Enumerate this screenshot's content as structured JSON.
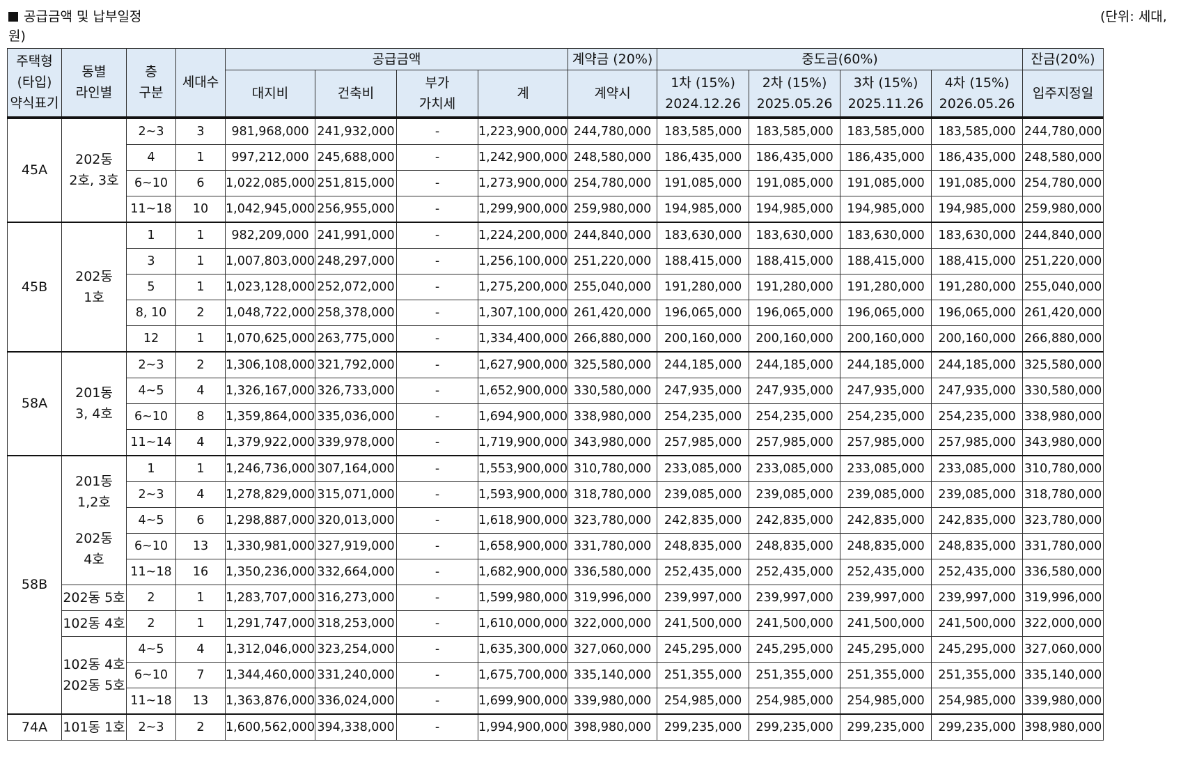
{
  "page": {
    "title": "공급금액 및 납부일정",
    "unit_line1": "(단위: 세대,",
    "unit_line2": "원)"
  },
  "header": {
    "type": [
      "주택형",
      "(타입)",
      "약식표기"
    ],
    "dong": [
      "동별",
      "라인별"
    ],
    "floor": [
      "층",
      "구분"
    ],
    "units": "세대수",
    "supply_group": "공급금액",
    "land": "대지비",
    "building": "건축비",
    "vat": [
      "부가",
      "가치세"
    ],
    "total": "계",
    "contract_group": "계약금 (20%)",
    "contract_sub": "계약시",
    "middle_group": "중도금(60%)",
    "m1": "1차 (15%)",
    "m1_date": "2024.12.26",
    "m2": "2차 (15%)",
    "m2_date": "2025.05.26",
    "m3": "3차 (15%)",
    "m3_date": "2025.11.26",
    "m4": "4차 (15%)",
    "m4_date": "2026.05.26",
    "balance_group": "잔금(20%)",
    "balance_sub": "입주지정일"
  },
  "groups": [
    {
      "type": "45A",
      "lines": [
        [
          "202동",
          "2호, 3호"
        ]
      ]
    },
    {
      "type": "45B",
      "lines": [
        [
          "202동",
          "1호"
        ]
      ]
    },
    {
      "type": "58A",
      "lines": [
        [
          "201동",
          "3, 4호"
        ]
      ]
    },
    {
      "type": "58B",
      "lines": [
        [
          "201동",
          "1,2호",
          "",
          "202동",
          "4호"
        ],
        [
          "202동 5호"
        ],
        [
          "102동 4호"
        ],
        [
          "102동 4호",
          "202동 5호"
        ]
      ]
    },
    {
      "type": "74A",
      "lines": [
        [
          "101동 1호"
        ]
      ]
    }
  ],
  "rows": [
    {
      "floor": "2~3",
      "units": "3",
      "land": "981,968,000",
      "building": "241,932,000",
      "vat": "-",
      "total": "1,223,900,000",
      "contract": "244,780,000",
      "m1": "183,585,000",
      "m2": "183,585,000",
      "m3": "183,585,000",
      "m4": "183,585,000",
      "balance": "244,780,000"
    },
    {
      "floor": "4",
      "units": "1",
      "land": "997,212,000",
      "building": "245,688,000",
      "vat": "-",
      "total": "1,242,900,000",
      "contract": "248,580,000",
      "m1": "186,435,000",
      "m2": "186,435,000",
      "m3": "186,435,000",
      "m4": "186,435,000",
      "balance": "248,580,000"
    },
    {
      "floor": "6~10",
      "units": "6",
      "land": "1,022,085,000",
      "building": "251,815,000",
      "vat": "-",
      "total": "1,273,900,000",
      "contract": "254,780,000",
      "m1": "191,085,000",
      "m2": "191,085,000",
      "m3": "191,085,000",
      "m4": "191,085,000",
      "balance": "254,780,000"
    },
    {
      "floor": "11~18",
      "units": "10",
      "land": "1,042,945,000",
      "building": "256,955,000",
      "vat": "-",
      "total": "1,299,900,000",
      "contract": "259,980,000",
      "m1": "194,985,000",
      "m2": "194,985,000",
      "m3": "194,985,000",
      "m4": "194,985,000",
      "balance": "259,980,000"
    },
    {
      "floor": "1",
      "units": "1",
      "land": "982,209,000",
      "building": "241,991,000",
      "vat": "-",
      "total": "1,224,200,000",
      "contract": "244,840,000",
      "m1": "183,630,000",
      "m2": "183,630,000",
      "m3": "183,630,000",
      "m4": "183,630,000",
      "balance": "244,840,000"
    },
    {
      "floor": "3",
      "units": "1",
      "land": "1,007,803,000",
      "building": "248,297,000",
      "vat": "-",
      "total": "1,256,100,000",
      "contract": "251,220,000",
      "m1": "188,415,000",
      "m2": "188,415,000",
      "m3": "188,415,000",
      "m4": "188,415,000",
      "balance": "251,220,000"
    },
    {
      "floor": "5",
      "units": "1",
      "land": "1,023,128,000",
      "building": "252,072,000",
      "vat": "-",
      "total": "1,275,200,000",
      "contract": "255,040,000",
      "m1": "191,280,000",
      "m2": "191,280,000",
      "m3": "191,280,000",
      "m4": "191,280,000",
      "balance": "255,040,000"
    },
    {
      "floor": "8, 10",
      "units": "2",
      "land": "1,048,722,000",
      "building": "258,378,000",
      "vat": "-",
      "total": "1,307,100,000",
      "contract": "261,420,000",
      "m1": "196,065,000",
      "m2": "196,065,000",
      "m3": "196,065,000",
      "m4": "196,065,000",
      "balance": "261,420,000"
    },
    {
      "floor": "12",
      "units": "1",
      "land": "1,070,625,000",
      "building": "263,775,000",
      "vat": "-",
      "total": "1,334,400,000",
      "contract": "266,880,000",
      "m1": "200,160,000",
      "m2": "200,160,000",
      "m3": "200,160,000",
      "m4": "200,160,000",
      "balance": "266,880,000"
    },
    {
      "floor": "2~3",
      "units": "2",
      "land": "1,306,108,000",
      "building": "321,792,000",
      "vat": "-",
      "total": "1,627,900,000",
      "contract": "325,580,000",
      "m1": "244,185,000",
      "m2": "244,185,000",
      "m3": "244,185,000",
      "m4": "244,185,000",
      "balance": "325,580,000"
    },
    {
      "floor": "4~5",
      "units": "4",
      "land": "1,326,167,000",
      "building": "326,733,000",
      "vat": "-",
      "total": "1,652,900,000",
      "contract": "330,580,000",
      "m1": "247,935,000",
      "m2": "247,935,000",
      "m3": "247,935,000",
      "m4": "247,935,000",
      "balance": "330,580,000"
    },
    {
      "floor": "6~10",
      "units": "8",
      "land": "1,359,864,000",
      "building": "335,036,000",
      "vat": "-",
      "total": "1,694,900,000",
      "contract": "338,980,000",
      "m1": "254,235,000",
      "m2": "254,235,000",
      "m3": "254,235,000",
      "m4": "254,235,000",
      "balance": "338,980,000"
    },
    {
      "floor": "11~14",
      "units": "4",
      "land": "1,379,922,000",
      "building": "339,978,000",
      "vat": "-",
      "total": "1,719,900,000",
      "contract": "343,980,000",
      "m1": "257,985,000",
      "m2": "257,985,000",
      "m3": "257,985,000",
      "m4": "257,985,000",
      "balance": "343,980,000"
    },
    {
      "floor": "1",
      "units": "1",
      "land": "1,246,736,000",
      "building": "307,164,000",
      "vat": "-",
      "total": "1,553,900,000",
      "contract": "310,780,000",
      "m1": "233,085,000",
      "m2": "233,085,000",
      "m3": "233,085,000",
      "m4": "233,085,000",
      "balance": "310,780,000"
    },
    {
      "floor": "2~3",
      "units": "4",
      "land": "1,278,829,000",
      "building": "315,071,000",
      "vat": "-",
      "total": "1,593,900,000",
      "contract": "318,780,000",
      "m1": "239,085,000",
      "m2": "239,085,000",
      "m3": "239,085,000",
      "m4": "239,085,000",
      "balance": "318,780,000"
    },
    {
      "floor": "4~5",
      "units": "6",
      "land": "1,298,887,000",
      "building": "320,013,000",
      "vat": "-",
      "total": "1,618,900,000",
      "contract": "323,780,000",
      "m1": "242,835,000",
      "m2": "242,835,000",
      "m3": "242,835,000",
      "m4": "242,835,000",
      "balance": "323,780,000"
    },
    {
      "floor": "6~10",
      "units": "13",
      "land": "1,330,981,000",
      "building": "327,919,000",
      "vat": "-",
      "total": "1,658,900,000",
      "contract": "331,780,000",
      "m1": "248,835,000",
      "m2": "248,835,000",
      "m3": "248,835,000",
      "m4": "248,835,000",
      "balance": "331,780,000"
    },
    {
      "floor": "11~18",
      "units": "16",
      "land": "1,350,236,000",
      "building": "332,664,000",
      "vat": "-",
      "total": "1,682,900,000",
      "contract": "336,580,000",
      "m1": "252,435,000",
      "m2": "252,435,000",
      "m3": "252,435,000",
      "m4": "252,435,000",
      "balance": "336,580,000"
    },
    {
      "floor": "2",
      "units": "1",
      "land": "1,283,707,000",
      "building": "316,273,000",
      "vat": "-",
      "total": "1,599,980,000",
      "contract": "319,996,000",
      "m1": "239,997,000",
      "m2": "239,997,000",
      "m3": "239,997,000",
      "m4": "239,997,000",
      "balance": "319,996,000"
    },
    {
      "floor": "2",
      "units": "1",
      "land": "1,291,747,000",
      "building": "318,253,000",
      "vat": "-",
      "total": "1,610,000,000",
      "contract": "322,000,000",
      "m1": "241,500,000",
      "m2": "241,500,000",
      "m3": "241,500,000",
      "m4": "241,500,000",
      "balance": "322,000,000"
    },
    {
      "floor": "4~5",
      "units": "4",
      "land": "1,312,046,000",
      "building": "323,254,000",
      "vat": "-",
      "total": "1,635,300,000",
      "contract": "327,060,000",
      "m1": "245,295,000",
      "m2": "245,295,000",
      "m3": "245,295,000",
      "m4": "245,295,000",
      "balance": "327,060,000"
    },
    {
      "floor": "6~10",
      "units": "7",
      "land": "1,344,460,000",
      "building": "331,240,000",
      "vat": "-",
      "total": "1,675,700,000",
      "contract": "335,140,000",
      "m1": "251,355,000",
      "m2": "251,355,000",
      "m3": "251,355,000",
      "m4": "251,355,000",
      "balance": "335,140,000"
    },
    {
      "floor": "11~18",
      "units": "13",
      "land": "1,363,876,000",
      "building": "336,024,000",
      "vat": "-",
      "total": "1,699,900,000",
      "contract": "339,980,000",
      "m1": "254,985,000",
      "m2": "254,985,000",
      "m3": "254,985,000",
      "m4": "254,985,000",
      "balance": "339,980,000"
    },
    {
      "floor": "2~3",
      "units": "2",
      "land": "1,600,562,000",
      "building": "394,338,000",
      "vat": "-",
      "total": "1,994,900,000",
      "contract": "398,980,000",
      "m1": "299,235,000",
      "m2": "299,235,000",
      "m3": "299,235,000",
      "m4": "299,235,000",
      "balance": "398,980,000"
    }
  ]
}
